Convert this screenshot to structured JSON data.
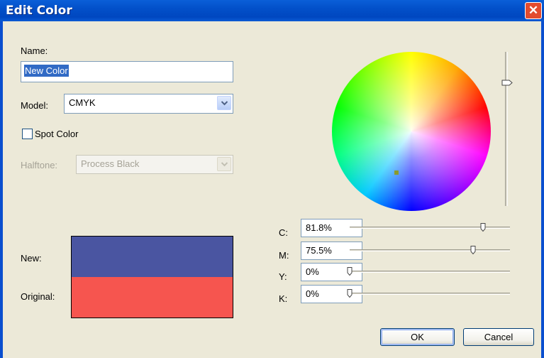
{
  "window": {
    "title": "Edit Color",
    "close_icon": "close-icon"
  },
  "form": {
    "name_label": "Name:",
    "name_value": "New Color",
    "model_label": "Model:",
    "model_value": "CMYK",
    "spot_color_label": "Spot Color",
    "spot_color_checked": false,
    "halftone_label": "Halftone:",
    "halftone_value": "Process Black"
  },
  "preview": {
    "new_label": "New:",
    "original_label": "Original:",
    "new_color": "#4a55a1",
    "original_color": "#f6554f"
  },
  "channels": [
    {
      "label": "C:",
      "value": "81.8%",
      "level": 0.818
    },
    {
      "label": "M:",
      "value": "75.5%",
      "level": 0.755
    },
    {
      "label": "Y:",
      "value": "0%",
      "level": 0
    },
    {
      "label": "K:",
      "value": "0%",
      "level": 0
    }
  ],
  "wheel": {
    "brightness_level": 0.82
  },
  "buttons": {
    "ok": "OK",
    "cancel": "Cancel"
  }
}
